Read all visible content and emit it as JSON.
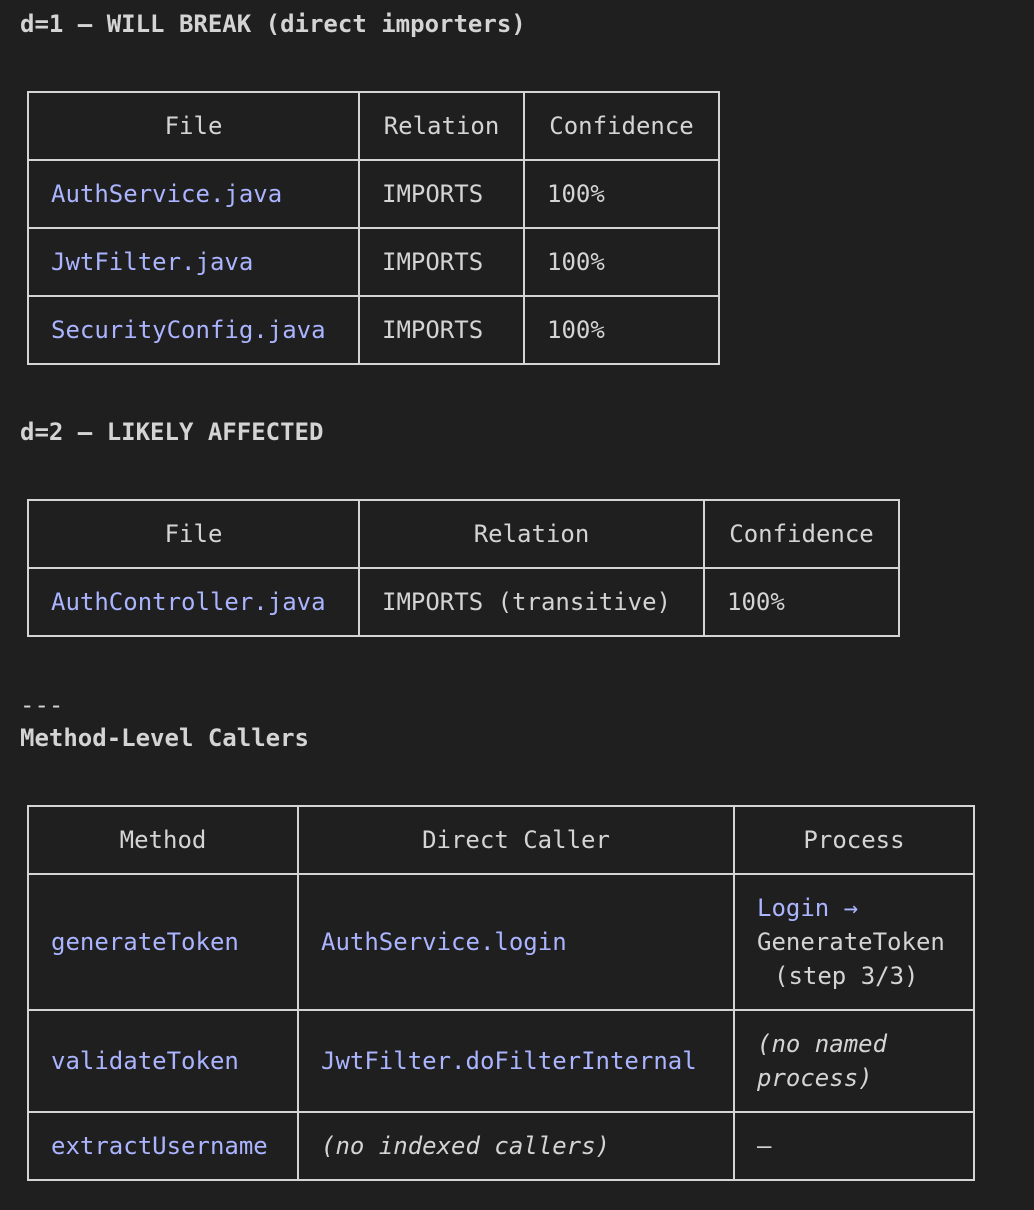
{
  "sections": {
    "d1_heading": "d=1 — WILL BREAK (direct importers)",
    "d2_heading": "d=2 — LIKELY AFFECTED",
    "separator": "---",
    "method_heading": "Method-Level Callers"
  },
  "d1_table": {
    "headers": [
      "File",
      "Relation",
      "Confidence"
    ],
    "rows": [
      {
        "file": "AuthService.java",
        "relation": "IMPORTS",
        "confidence": "100%"
      },
      {
        "file": "JwtFilter.java",
        "relation": "IMPORTS",
        "confidence": "100%"
      },
      {
        "file": "SecurityConfig.java",
        "relation": "IMPORTS",
        "confidence": "100%"
      }
    ]
  },
  "d2_table": {
    "headers": [
      "File",
      "Relation",
      "Confidence"
    ],
    "rows": [
      {
        "file": "AuthController.java",
        "relation": "IMPORTS (transitive)",
        "confidence": "100%"
      }
    ]
  },
  "method_table": {
    "headers": [
      "Method",
      "Direct Caller",
      "Process"
    ],
    "rows": [
      {
        "method": "generateToken",
        "caller": "AuthService.login",
        "process_link": "Login →",
        "process_line2": "GenerateToken",
        "process_line3": "(step 3/3)"
      },
      {
        "method": "validateToken",
        "caller": "JwtFilter.doFilterInternal",
        "process": "(no named process)"
      },
      {
        "method": "extractUsername",
        "caller": "(no indexed callers)",
        "process": "—"
      }
    ]
  },
  "colors": {
    "background": "#1f1f1f",
    "text": "#d4d4d4",
    "link": "#aab4ff"
  }
}
